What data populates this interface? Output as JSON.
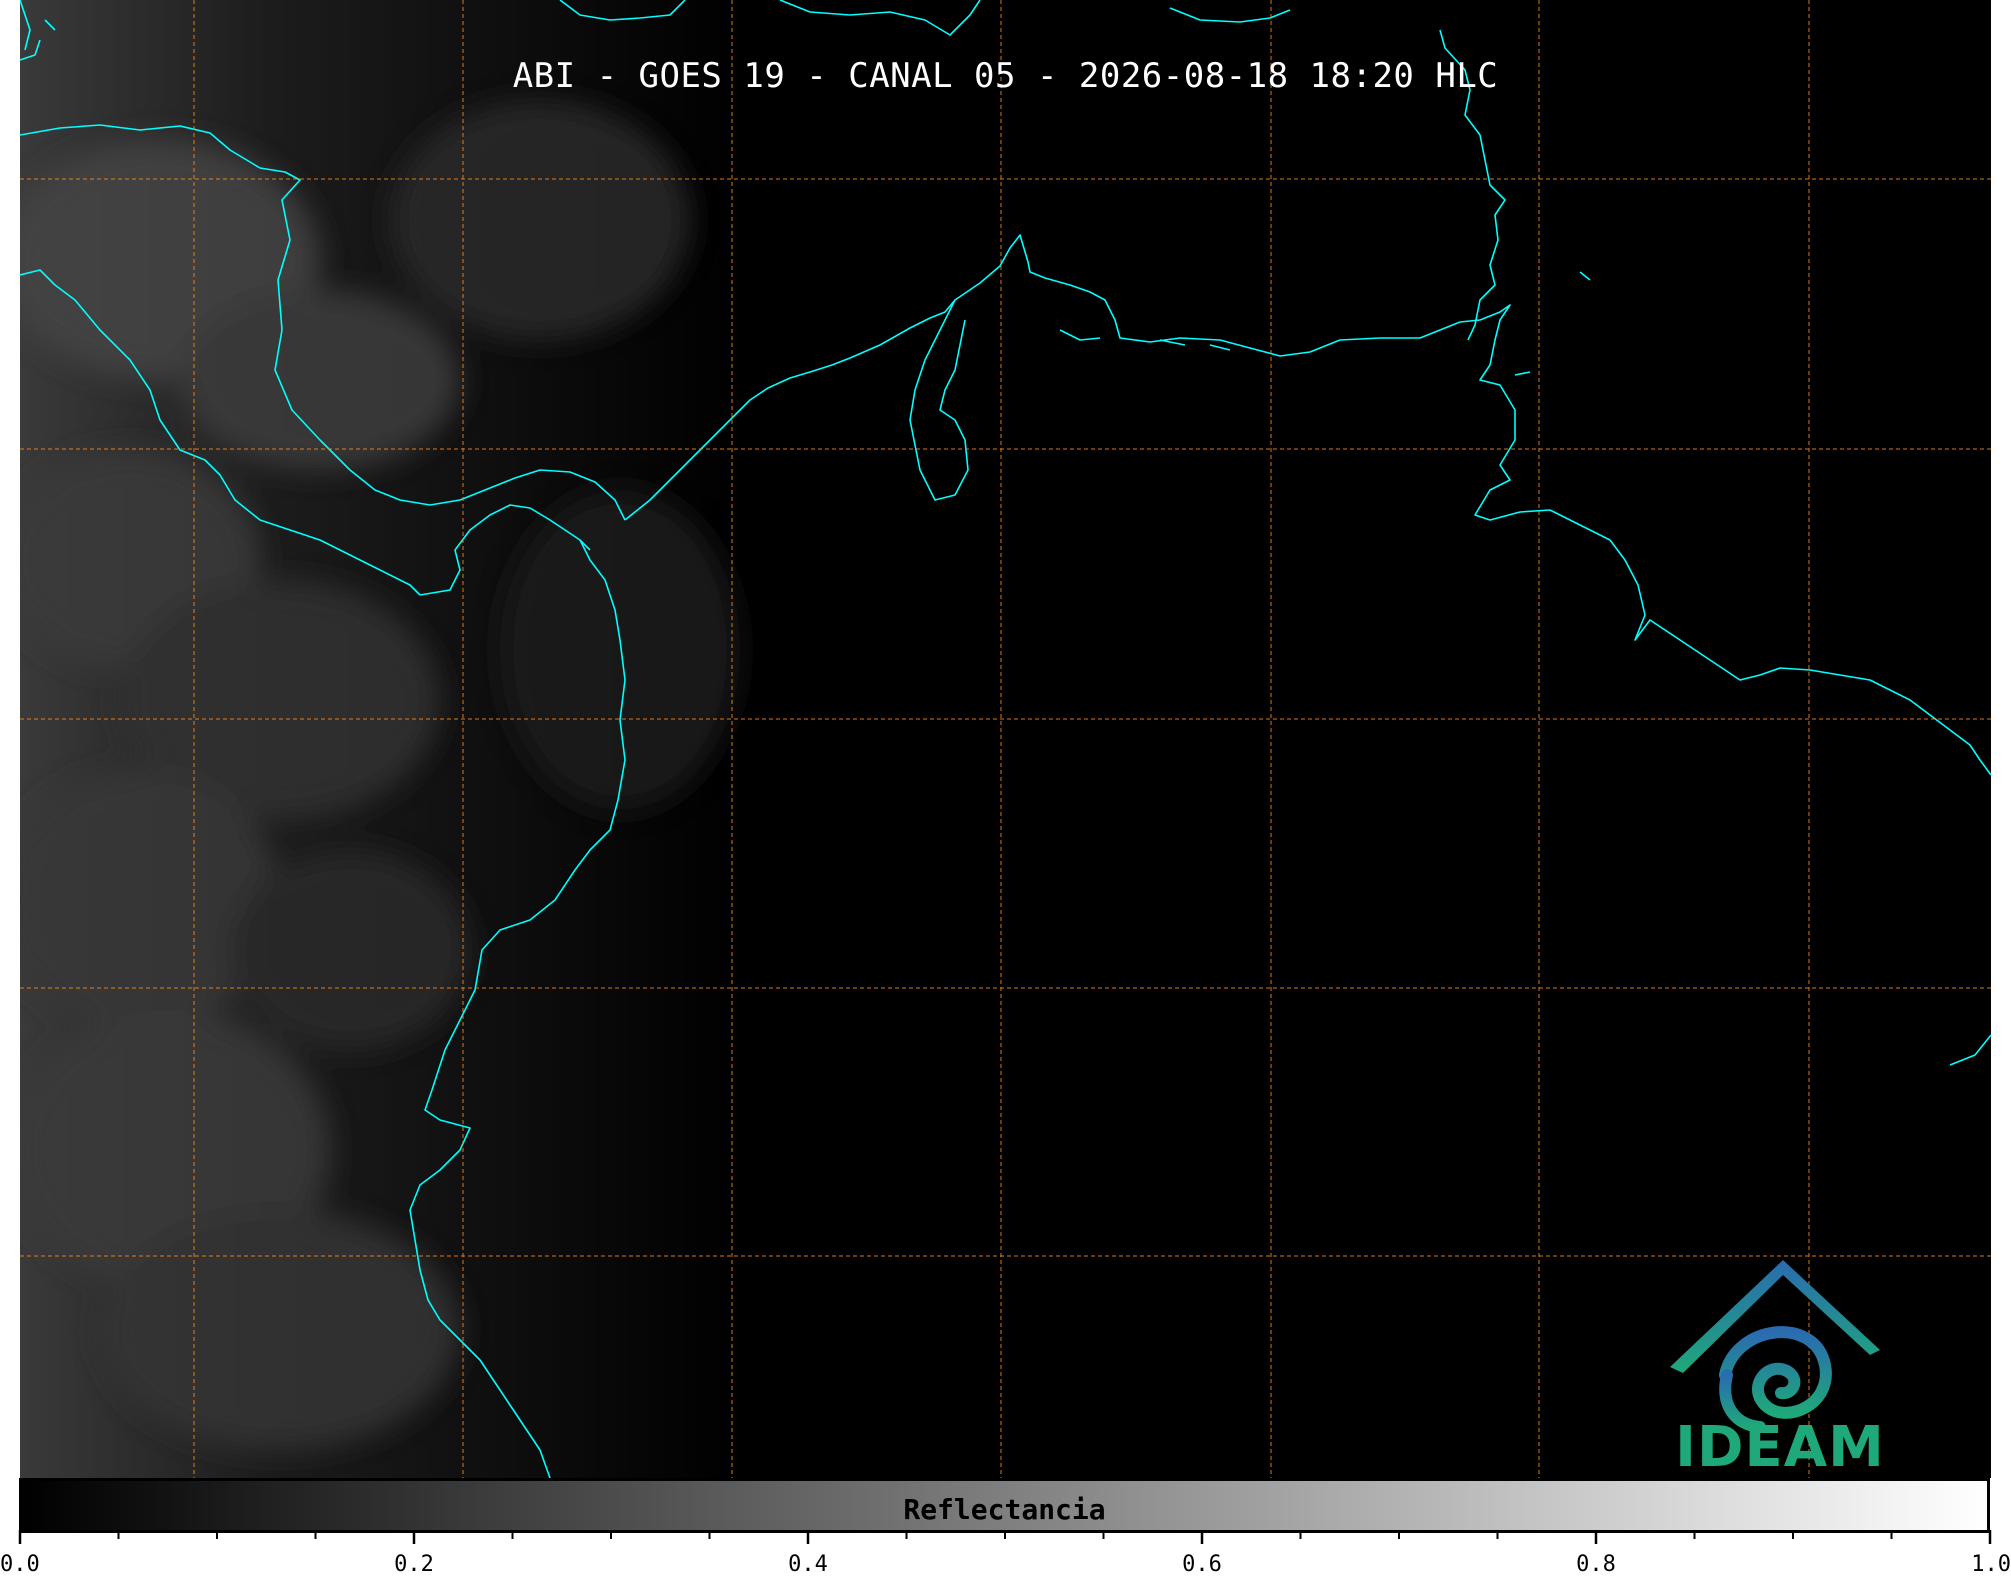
{
  "title": "ABI - GOES 19 - CANAL 05 - 2026-08-18 18:20 HLC",
  "logo": {
    "text": "IDEAM",
    "icon": "ideam-swirl-logo-icon"
  },
  "colorbar": {
    "label": "Reflectancia",
    "range": [
      0.0,
      1.0
    ],
    "tick_labels": [
      "0.0",
      "0.2",
      "0.4",
      "0.6",
      "0.8",
      "1.0"
    ],
    "colormap": "grayscale"
  },
  "colors": {
    "coastline": "#00ffff",
    "grid": "#ff8c1a",
    "background": "#000000",
    "logo": "#1fa87a"
  }
}
